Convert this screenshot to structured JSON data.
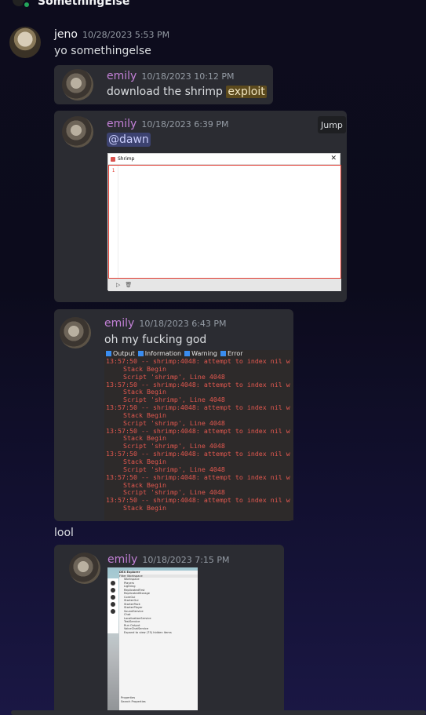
{
  "server": {
    "name": "SomethingElse"
  },
  "message": {
    "author": "jeno",
    "timestamp": "10/28/2023 5:53 PM",
    "text": "yo somethingelse"
  },
  "forwards": [
    {
      "author": "emily",
      "timestamp": "10/18/2023 10:12 PM",
      "text_before": "download the shrimp ",
      "text_highlight": "exploit"
    },
    {
      "author": "emily",
      "timestamp": "10/18/2023 6:39 PM",
      "mention": "@dawn",
      "jump_label": "Jump",
      "attachment": {
        "window_title": "Shrimp",
        "line_number": "1",
        "close_glyph": "✕",
        "run_glyph": "▷",
        "clear_glyph": "🗑"
      }
    },
    {
      "author": "emily",
      "timestamp": "10/18/2023 6:43 PM",
      "text": "oh my fucking god",
      "output": {
        "filters": [
          "Output",
          "Information",
          "Warning",
          "Error"
        ],
        "lines": [
          {
            "text": "13:57:50 -- shrimp:4048: attempt to index nil w",
            "indent": false
          },
          {
            "text": "Stack Begin",
            "indent": true
          },
          {
            "text": "Script 'shrimp', Line 4048",
            "indent": true
          },
          {
            "text": "13:57:50 -- shrimp:4048: attempt to index nil w",
            "indent": false
          },
          {
            "text": "Stack Begin",
            "indent": true
          },
          {
            "text": "Script 'shrimp', Line 4048",
            "indent": true
          },
          {
            "text": "13:57:50 -- shrimp:4048: attempt to index nil w",
            "indent": false
          },
          {
            "text": "Stack Begin",
            "indent": true
          },
          {
            "text": "Script 'shrimp', Line 4048",
            "indent": true
          },
          {
            "text": "13:57:50 -- shrimp:4048: attempt to index nil w",
            "indent": false
          },
          {
            "text": "Stack Begin",
            "indent": true
          },
          {
            "text": "Script 'shrimp', Line 4048",
            "indent": true
          },
          {
            "text": "13:57:50 -- shrimp:4048: attempt to index nil w",
            "indent": false
          },
          {
            "text": "Stack Begin",
            "indent": true
          },
          {
            "text": "Script 'shrimp', Line 4048",
            "indent": true
          },
          {
            "text": "13:57:50 -- shrimp:4048: attempt to index nil w",
            "indent": false
          },
          {
            "text": "Stack Begin",
            "indent": true
          },
          {
            "text": "Script 'shrimp', Line 4048",
            "indent": true
          },
          {
            "text": "13:57:50 -- shrimp:4048: attempt to index nil w",
            "indent": false
          },
          {
            "text": "Stack Begin",
            "indent": true
          }
        ]
      }
    },
    {
      "author": "emily",
      "timestamp": "10/18/2023 7:15 PM",
      "explorer": {
        "title": "DEX Explorer",
        "filter": "Filter Workspace",
        "items": [
          "Workspace",
          "Players",
          "Lighting",
          "ReplicatedFirst",
          "ReplicatedStorage",
          "CoreGui",
          "StarterGui",
          "StarterPack",
          "StarterPlayer",
          "SoundService",
          "Chat",
          "LocalizationService",
          "TestService",
          "Run Output",
          "VoiceChatService",
          "Expand to view (75) hidden items"
        ],
        "footer": [
          "Properties",
          "Search Properties"
        ]
      }
    }
  ],
  "followup": {
    "text": "lool"
  },
  "colors": {
    "accent_name": "#c280d6",
    "online": "#23a55a",
    "error_text": "#e2584f"
  }
}
